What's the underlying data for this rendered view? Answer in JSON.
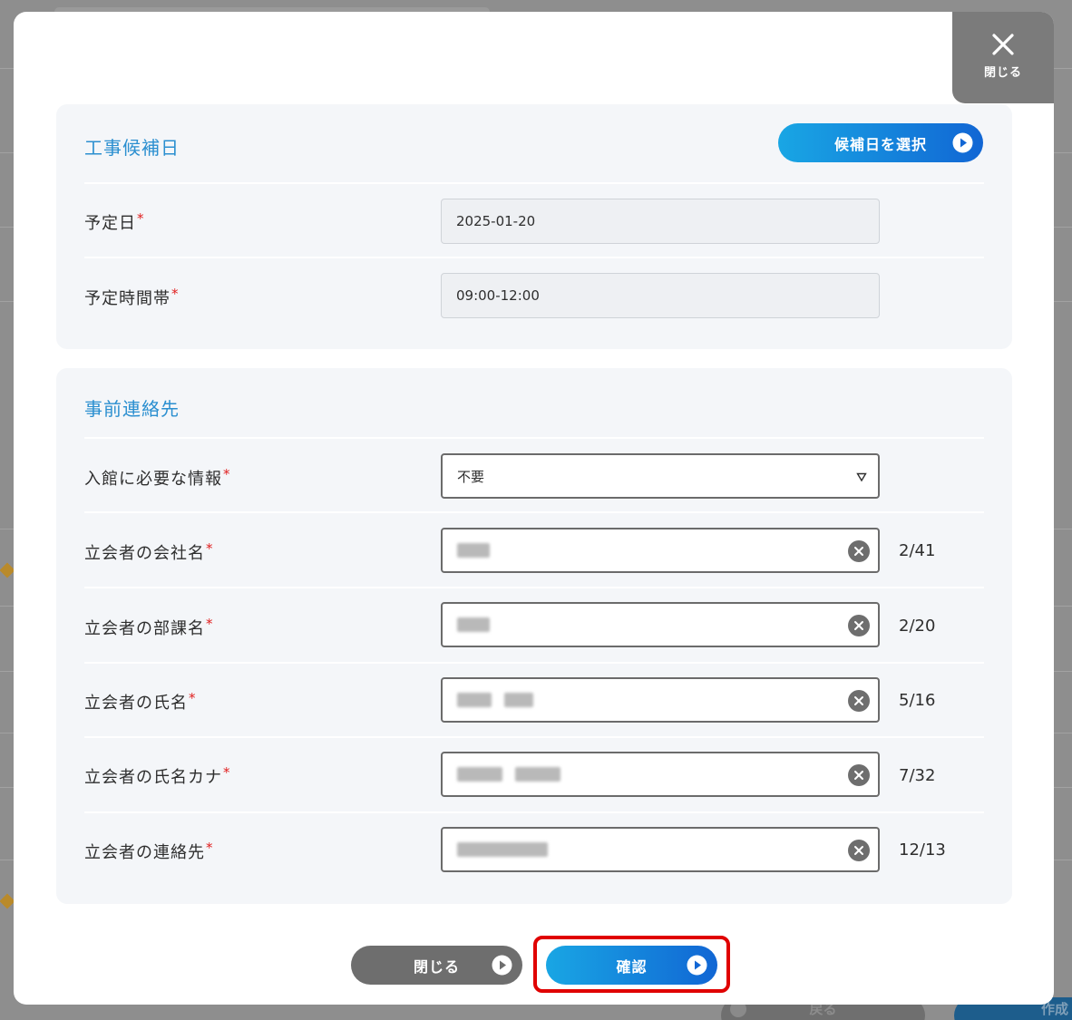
{
  "background": {
    "back_label": "戻る",
    "create_label": "作成"
  },
  "modal": {
    "close_tab_label": "閉じる"
  },
  "schedule": {
    "title": "工事候補日",
    "select_date_button": "候補日を選択",
    "fields": [
      {
        "label": "予定日",
        "required": "*",
        "value": "2025-01-20"
      },
      {
        "label": "予定時間帯",
        "required": "*",
        "value": "09:00-12:00"
      }
    ]
  },
  "contact": {
    "title": "事前連絡先",
    "entry_info": {
      "label": "入館に必要な情報",
      "required": "*",
      "value": "不要"
    },
    "fields": [
      {
        "label": "立会者の会社名",
        "required": "*",
        "counter": "2/41"
      },
      {
        "label": "立会者の部課名",
        "required": "*",
        "counter": "2/20"
      },
      {
        "label": "立会者の氏名",
        "required": "*",
        "counter": "5/16"
      },
      {
        "label": "立会者の氏名カナ",
        "required": "*",
        "counter": "7/32"
      },
      {
        "label": "立会者の連絡先",
        "required": "*",
        "counter": "12/13"
      }
    ]
  },
  "footer": {
    "close_button": "閉じる",
    "confirm_button": "確認"
  },
  "colors": {
    "accent_blue": "#2b8fd0",
    "button_gradient_start": "#19a6e4",
    "button_gradient_end": "#1166d4",
    "required_red": "#e02020",
    "highlight_red": "#e00000",
    "gray_button": "#6e6e6e"
  },
  "icons": {
    "close_tab": "close-x-icon",
    "play": "play-circle-icon",
    "clear": "clear-circle-icon",
    "select": "triangle-down-icon"
  }
}
